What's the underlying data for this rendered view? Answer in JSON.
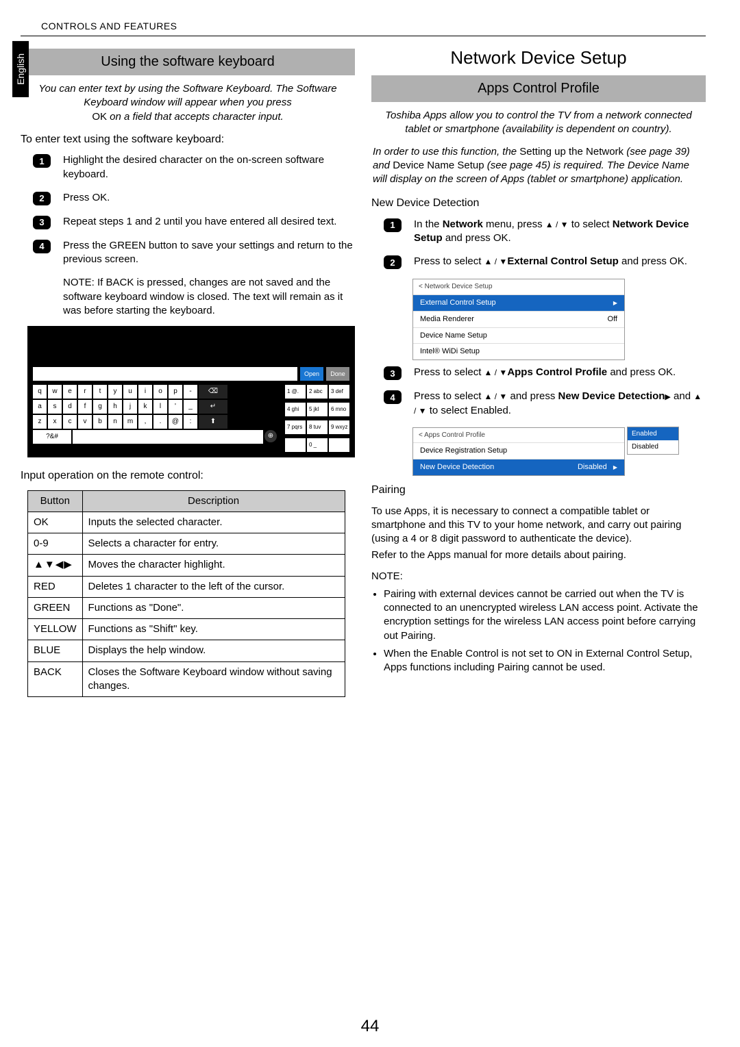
{
  "header": "CONTROLS AND FEATURES",
  "lang_tab": "English",
  "page_number": "44",
  "left": {
    "banner": "Using the software keyboard",
    "intro_line1": "You can enter text by using the Software Keyboard. The Software Keyboard window will appear when you press",
    "intro_line2_prefix": "OK",
    "intro_line2_rest": " on a field that accepts character input.",
    "sub1": "To enter text using the software keyboard:",
    "steps": [
      "Highlight the desired character on the on-screen software keyboard.",
      "Press OK.",
      "Repeat steps 1 and 2 until you have entered all desired text.",
      "Press the GREEN button to save your settings and return to the previous screen."
    ],
    "note": "NOTE: If BACK is pressed, changes are not saved and the software keyboard window is closed. The text will remain as it was before starting the keyboard.",
    "kb_open": "Open",
    "kb_done": "Done",
    "sub2": "Input operation on the remote control:",
    "table": {
      "h1": "Button",
      "h2": "Description",
      "rows": [
        {
          "b": "OK",
          "d": "Inputs the selected character."
        },
        {
          "b": "0-9",
          "d": "Selects a character for entry."
        },
        {
          "b": "__ARROWS__",
          "d": "Moves the character highlight."
        },
        {
          "b": "RED",
          "d": "Deletes 1 character to the left of the cursor."
        },
        {
          "b": "GREEN",
          "d": "Functions as \"Done\"."
        },
        {
          "b": "YELLOW",
          "d": "Functions as \"Shift\" key."
        },
        {
          "b": "BLUE",
          "d": "Displays the help window."
        },
        {
          "b": "BACK",
          "d": "Closes the Software Keyboard window without saving changes."
        }
      ]
    }
  },
  "right": {
    "title": "Network Device Setup",
    "banner": "Apps Control Profile",
    "intro": "Toshiba Apps allow you to control the TV from a network connected tablet or smartphone (availability is dependent on country).",
    "req_prefix": "In order to use this function, the ",
    "req_link1": "Setting up the Network",
    "req_mid1": " (see page 39) and ",
    "req_link2": "Device Name Setup",
    "req_mid2": " (see page 45) is required. The Device Name will display on the screen of Apps (tablet or smartphone) application.",
    "sub_ndd": "New Device Detection",
    "ndd_steps": [
      {
        "pre": "In the ",
        "b1": "Network",
        "mid": " menu, press ",
        "arrows": true,
        "mid2": " to select ",
        "b2": "Network Device Setup",
        "end": " and press OK."
      },
      {
        "pre": "Press ",
        "arrows": true,
        "mid": " to select ",
        "b1": "External Control Setup",
        "end": " and press OK."
      },
      {
        "pre": "Press ",
        "arrows": true,
        "mid": " to select ",
        "b1": "Apps Control Profile",
        "end": " and press OK."
      },
      {
        "pre": "Press ",
        "arrows": true,
        "mid": " to select ",
        "b1": "New Device Detection",
        "mid2": " and press ",
        "rarrow": true,
        "mid3": " and ",
        "arrows2": true,
        "end": " to select Enabled."
      }
    ],
    "menu1": {
      "title": "< Network Device Setup",
      "rows": [
        {
          "l": "External Control Setup",
          "r": "",
          "sel": true,
          "arrow": true
        },
        {
          "l": "Media Renderer",
          "r": "Off"
        },
        {
          "l": "Device Name Setup",
          "r": ""
        },
        {
          "l": "Intel® WiDi Setup",
          "r": ""
        }
      ]
    },
    "menu2": {
      "title": "< Apps Control Profile",
      "rows": [
        {
          "l": "Device Registration Setup",
          "r": ""
        },
        {
          "l": "New Device Detection",
          "r": "Disabled",
          "sel": true,
          "arrow": true,
          "dropdown": true
        }
      ],
      "dd": [
        "Enabled",
        "Disabled"
      ]
    },
    "sub_pairing": "Pairing",
    "pairing_p1": "To use Apps, it is necessary to connect a compatible tablet or smartphone and this TV to your home network, and carry out pairing (using a 4 or 8 digit password to authenticate the device).",
    "pairing_p2": "Refer to the Apps manual for more details about pairing.",
    "note_label": "NOTE:",
    "notes": [
      "Pairing with external devices cannot be carried out when the TV is connected to an unencrypted wireless LAN access point. Activate the encryption settings for the wireless LAN access point before carrying out Pairing.",
      "When the Enable Control is not set to ON in External Control Setup, Apps functions including Pairing cannot be used."
    ]
  }
}
